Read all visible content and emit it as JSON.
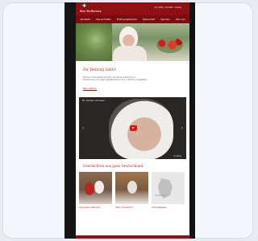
{
  "site": {
    "logo_text": "das Rotkreuz",
    "top_links": "Ihre Hilfe • Kontakt • Presse"
  },
  "nav": {
    "items": [
      "Startseite",
      "Wie wir helfen",
      "Erfahrungsberichte",
      "Patenschaft",
      "Spenden",
      "Über uns"
    ]
  },
  "section_1": {
    "title": "Ihr Beitrag zählt!",
    "paragraph": "Mit Ihrer Unterstützung helfen Sie älteren Menschen in Deutschland, ihr Leben selbstbestimmt und in Würde zu gestalten.",
    "link": "Mehr erfahren"
  },
  "video": {
    "title": "Ein Lächeln schenken",
    "bottom_text": "YouTube"
  },
  "section_2": {
    "title": "Geschichten aus ganz Deutschland"
  },
  "cards": [
    {
      "caption": "Gemeinsam statt allein"
    },
    {
      "caption": "Hilfe, die ankommt"
    },
    {
      "caption": "Unser Netzwerk"
    }
  ],
  "map": {
    "label": "Deutschland"
  },
  "icons": {
    "play": "play-icon",
    "prev": "chevron-left-icon",
    "next": "chevron-right-icon"
  },
  "colors": {
    "brand_red": "#8f1014",
    "nav_red": "#7d0c10",
    "title_red": "#c81f1f"
  }
}
